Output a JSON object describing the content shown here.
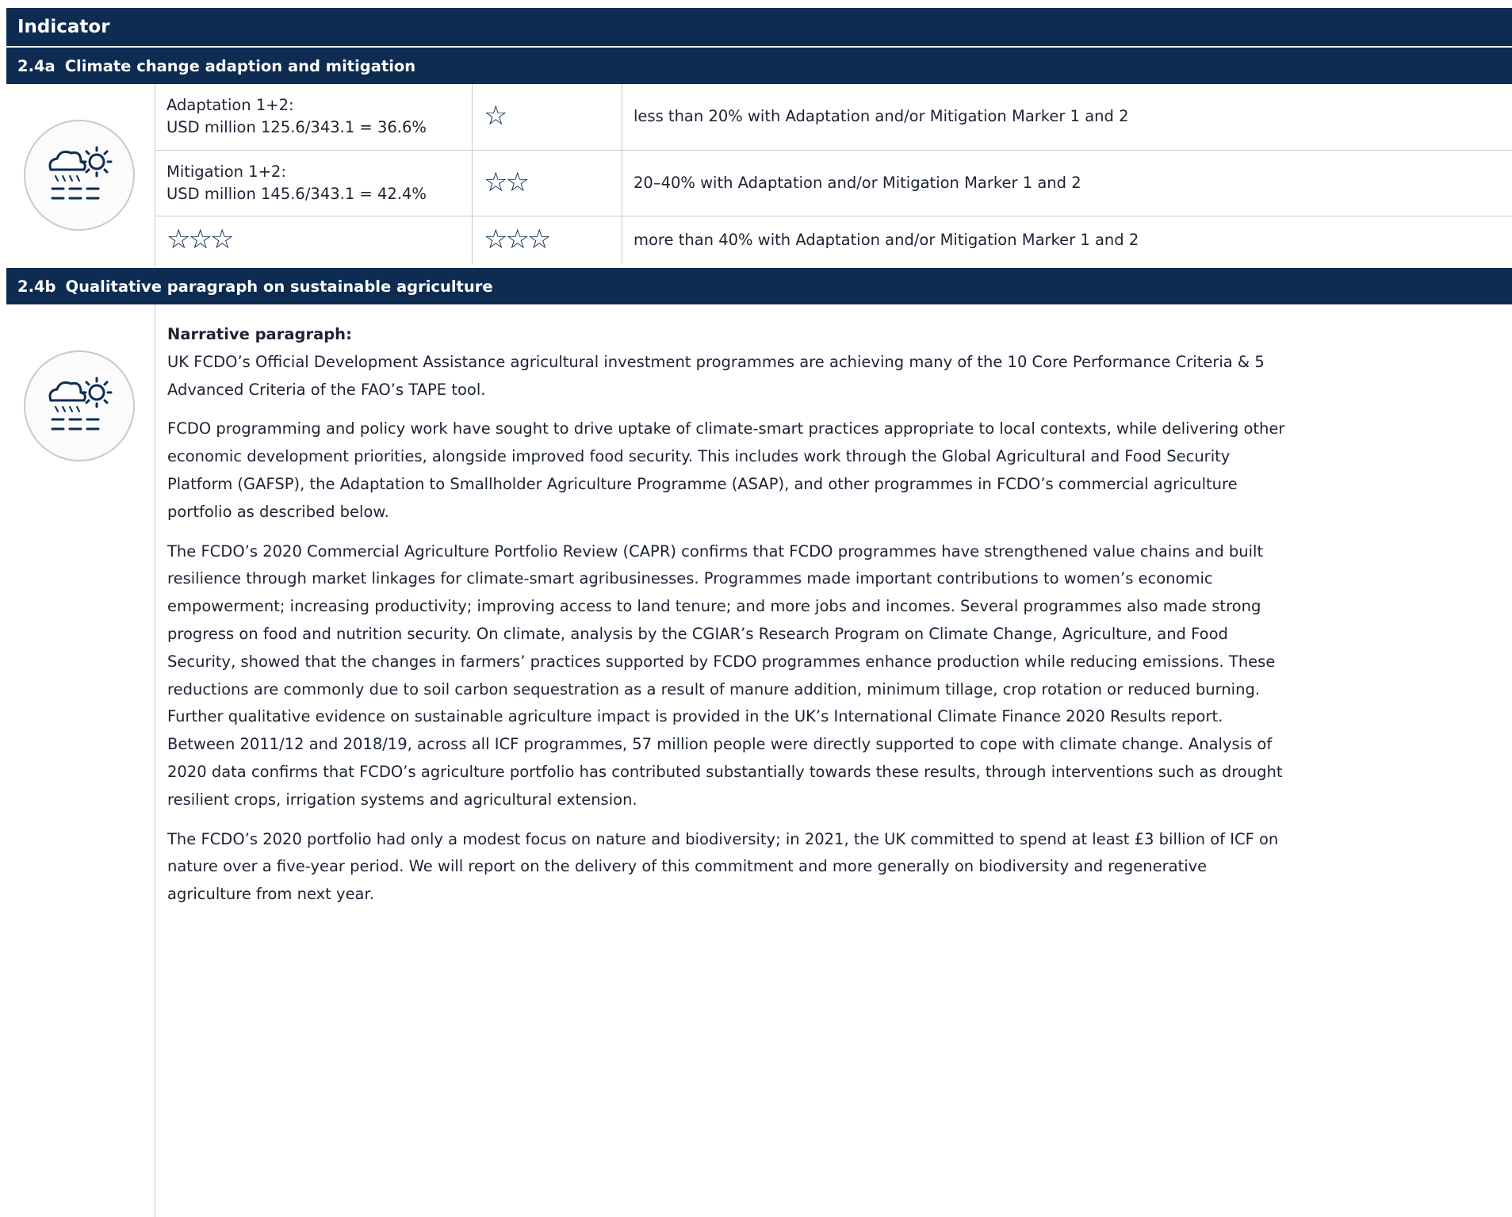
{
  "header": {
    "title": "Indicator"
  },
  "section_a": {
    "code": "2.4a",
    "title": "Climate change adaption and mitigation",
    "icon": "weather-climate-icon",
    "rows": [
      {
        "line1": "Adaptation 1+2:",
        "line2": "USD million 125.6/343.1 = 36.6%",
        "rating_stars": "☆",
        "criterion": "less than 20% with Adaptation and/or Mitigation Marker 1 and 2"
      },
      {
        "line1": "Mitigation 1+2:",
        "line2": "USD million 145.6/343.1 = 42.4%",
        "rating_stars": "☆☆",
        "criterion": "20–40% with Adaptation and/or Mitigation Marker 1 and 2"
      },
      {
        "score_stars": "☆☆☆",
        "rating_stars": "☆☆☆",
        "criterion": "more than 40% with Adaptation and/or Mitigation Marker 1 and 2"
      }
    ]
  },
  "section_b": {
    "code": "2.4b",
    "title": "Qualitative paragraph on sustainable agriculture",
    "icon": "weather-climate-icon",
    "narrative_heading": "Narrative paragraph:",
    "paragraphs": [
      "UK FCDO’s Official Development Assistance agricultural investment programmes are achieving many of the 10 Core Performance Criteria & 5 Advanced Criteria of the FAO’s TAPE tool.",
      "FCDO programming and policy work have sought to drive uptake of climate-smart practices appropriate to local contexts, while delivering other economic development priorities, alongside improved food security. This includes work through the Global Agricultural and Food Security Platform (GAFSP), the Adaptation to Smallholder Agriculture Programme (ASAP), and other programmes in FCDO’s commercial agriculture portfolio as described below.",
      "The FCDO’s 2020 Commercial Agriculture Portfolio Review (CAPR) confirms that FCDO programmes have strengthened value chains and built resilience through market linkages for climate-smart agribusinesses. Programmes made important contributions to women’s economic empowerment; increasing productivity; improving access to land tenure; and more jobs and incomes. Several programmes also made strong progress on food and nutrition security. On climate, analysis by the CGIAR’s Research Program on Climate Change, Agriculture, and Food Security, showed that the changes in farmers’ practices supported by FCDO programmes enhance production while reducing emissions. These reductions are commonly due to soil carbon sequestration as a result of manure addition, minimum tillage, crop rotation or reduced burning. Further qualitative evidence on sustainable agriculture impact is provided in the UK’s International Climate Finance 2020 Results report. Between 2011/12 and 2018/19, across all ICF programmes, 57 million people were directly supported to cope with climate change. Analysis of 2020 data confirms that FCDO’s agriculture portfolio has contributed substantially towards these results, through interventions such as drought resilient crops, irrigation systems and agricultural extension.",
      "The FCDO’s 2020 portfolio had only a modest focus on nature and biodiversity; in 2021, the UK committed to spend at least £3 billion of ICF on nature over a five-year period. We will report on the delivery of this commitment and more generally on biodiversity and regenerative agriculture from next year."
    ]
  },
  "colors": {
    "header_bg": "#0e2b52",
    "rule": "#c7c9cd",
    "text": "#1c2333"
  }
}
